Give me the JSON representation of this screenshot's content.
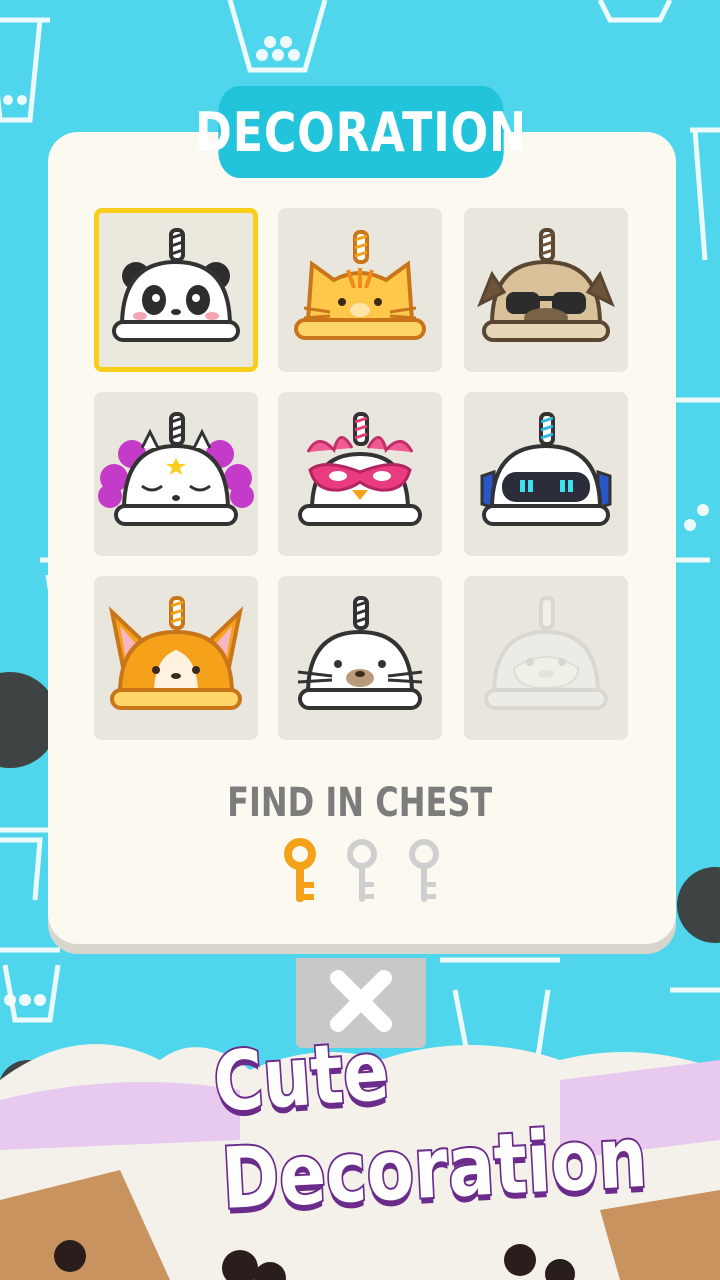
{
  "header": {
    "title": "DECORATION"
  },
  "decorations": [
    {
      "name": "panda",
      "state": "selected"
    },
    {
      "name": "cat",
      "state": "unlocked"
    },
    {
      "name": "pug",
      "state": "unlocked"
    },
    {
      "name": "unicorn",
      "state": "unlocked"
    },
    {
      "name": "masked-bird",
      "state": "unlocked"
    },
    {
      "name": "robot",
      "state": "unlocked"
    },
    {
      "name": "corgi",
      "state": "unlocked"
    },
    {
      "name": "seal",
      "state": "unlocked"
    },
    {
      "name": "penguin",
      "state": "locked"
    }
  ],
  "chest": {
    "label": "FIND IN CHEST",
    "keys_collected": 1,
    "keys_total": 3
  },
  "close_icon": "close-x-icon",
  "promo": {
    "line1": "Cute",
    "line2": "Decoration"
  },
  "colors": {
    "background": "#4fd6ec",
    "title_tab": "#22c4dc",
    "panel": "#fbf9f0",
    "selected_border": "#f7cf1b",
    "key_active": "#f5a11a",
    "key_inactive": "#cfcfcf",
    "promo_outline": "#6b2b8b"
  }
}
